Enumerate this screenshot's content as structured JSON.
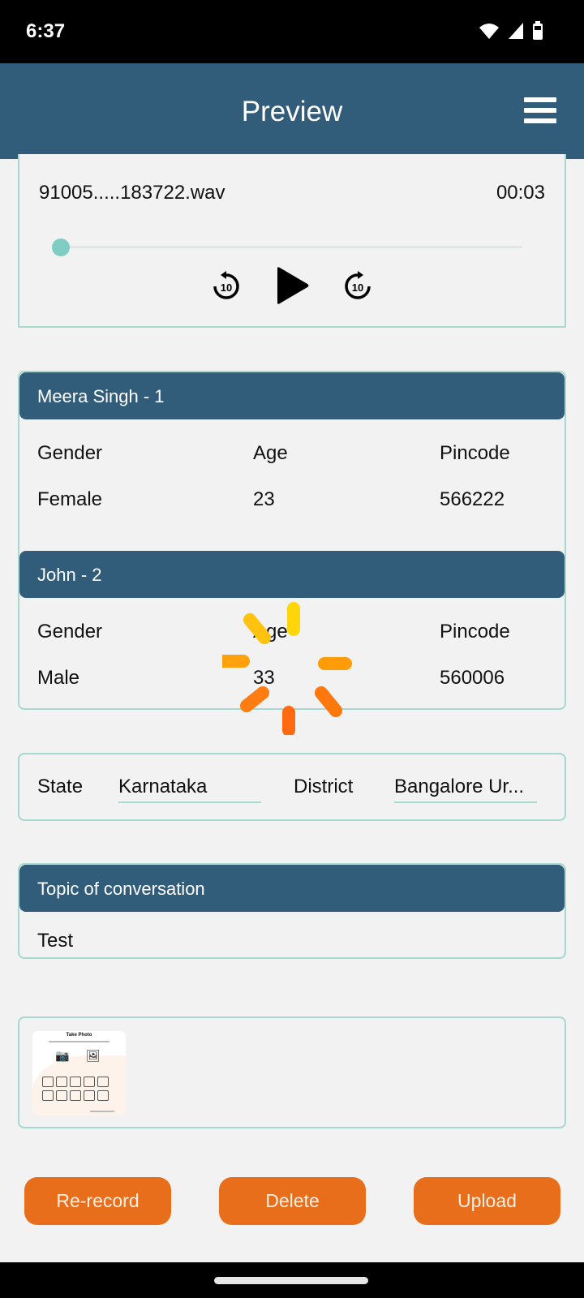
{
  "status_bar": {
    "time": "6:37",
    "icons": [
      "wifi-icon",
      "signal-icon",
      "battery-icon"
    ]
  },
  "app_bar": {
    "title": "Preview",
    "menu_icon": "hamburger-menu-icon"
  },
  "player": {
    "file_name": "91005.....183722.wav",
    "duration": "00:03",
    "progress_fraction": 0,
    "controls": [
      "rewind-10-icon",
      "play-icon",
      "forward-10-icon"
    ]
  },
  "persons": [
    {
      "header": "Meera Singh  - 1",
      "labels": [
        "Gender",
        "Age",
        "Pincode"
      ],
      "values": [
        "Female",
        "23",
        "566222"
      ]
    },
    {
      "header": "John - 2",
      "labels": [
        "Gender",
        "Age",
        "Pincode"
      ],
      "values": [
        "Male",
        "33",
        "560006"
      ]
    }
  ],
  "location": {
    "state_label": "State",
    "state_value": "Karnataka",
    "district_label": "District",
    "district_value": "Bangalore Ur..."
  },
  "topic": {
    "header": "Topic of conversation",
    "value": "Test"
  },
  "photo_thumbnail": {
    "title": "Take Photo"
  },
  "buttons": {
    "rerecord": "Re-record",
    "delete": "Delete",
    "upload": "Upload"
  },
  "colors": {
    "primary": "#315d7a",
    "accent": "#e86e1c",
    "border": "#a7d8d0",
    "slider": "#7fccc3",
    "background": "#f2f2f2"
  },
  "loading": true
}
